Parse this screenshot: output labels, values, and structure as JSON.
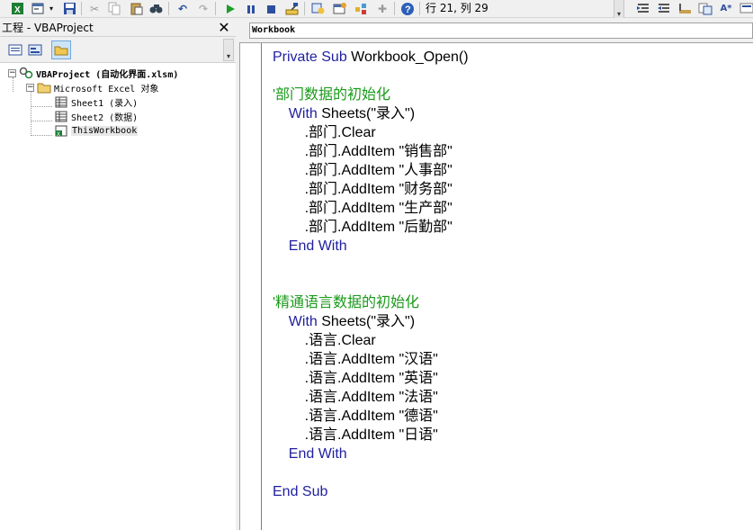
{
  "toolbar": {
    "buttons": [
      "excel-icon",
      "insert-userform-icon",
      "dropdown-arrow-icon",
      "save-icon",
      "cut-icon",
      "copy-icon",
      "paste-icon",
      "find-icon",
      "undo-icon",
      "redo-icon",
      "run-icon",
      "break-icon",
      "reset-icon",
      "design-mode-icon",
      "project-explorer-icon",
      "properties-icon",
      "object-browser-icon",
      "toolbox-icon",
      "help-icon"
    ],
    "cursor_position": "行 21, 列 29",
    "right_buttons": [
      "indent-icon",
      "outdent-icon",
      "toggle-breakpoint-icon",
      "comment-block-icon",
      "quick-info-icon"
    ]
  },
  "project": {
    "title": "工程 - VBAProject",
    "close_glyph": "✕",
    "tree": {
      "root": "VBAProject (自动化界面.xlsm)",
      "folder": "Microsoft Excel 对象",
      "items": [
        "Sheet1 (录入)",
        "Sheet2 (数据)",
        "ThisWorkbook"
      ]
    }
  },
  "code": {
    "object_selector": "Workbook",
    "lines": [
      [
        {
          "t": "Private Sub ",
          "c": "kw"
        },
        {
          "t": "Workbook_Open()",
          "c": "tx"
        }
      ],
      [],
      [
        {
          "t": "'部门数据的初始化",
          "c": "cm"
        }
      ],
      [
        {
          "t": "    With ",
          "c": "kw"
        },
        {
          "t": "Sheets(\"录入\")",
          "c": "tx"
        }
      ],
      [
        {
          "t": "        .部门.Clear",
          "c": "tx"
        }
      ],
      [
        {
          "t": "        .部门.AddItem \"销售部\"",
          "c": "tx"
        }
      ],
      [
        {
          "t": "        .部门.AddItem \"人事部\"",
          "c": "tx"
        }
      ],
      [
        {
          "t": "        .部门.AddItem \"财务部\"",
          "c": "tx"
        }
      ],
      [
        {
          "t": "        .部门.AddItem \"生产部\"",
          "c": "tx"
        }
      ],
      [
        {
          "t": "        .部门.AddItem \"后勤部\"",
          "c": "tx"
        }
      ],
      [
        {
          "t": "    End With",
          "c": "kw"
        }
      ],
      [],
      [],
      [
        {
          "t": "'精通语言数据的初始化",
          "c": "cm"
        }
      ],
      [
        {
          "t": "    With ",
          "c": "kw"
        },
        {
          "t": "Sheets(\"录入\")",
          "c": "tx"
        }
      ],
      [
        {
          "t": "        .语言.Clear",
          "c": "tx"
        }
      ],
      [
        {
          "t": "        .语言.AddItem \"汉语\"",
          "c": "tx"
        }
      ],
      [
        {
          "t": "        .语言.AddItem \"英语\"",
          "c": "tx"
        }
      ],
      [
        {
          "t": "        .语言.AddItem \"法语\"",
          "c": "tx"
        }
      ],
      [
        {
          "t": "        .语言.AddItem \"德语\"",
          "c": "tx"
        }
      ],
      [
        {
          "t": "        .语言.AddItem \"日语\"",
          "c": "tx"
        }
      ],
      [
        {
          "t": "    End With",
          "c": "kw"
        }
      ],
      [],
      [
        {
          "t": "End Sub",
          "c": "kw"
        }
      ]
    ]
  }
}
